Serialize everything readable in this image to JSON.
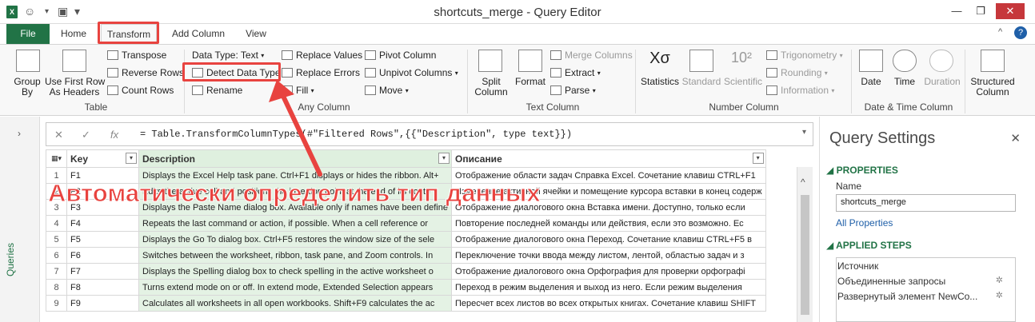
{
  "window": {
    "title": "shortcuts_merge - Query Editor",
    "app_icon": "X",
    "buttons": {
      "minimize": "—",
      "restore": "❐",
      "close": "✕"
    }
  },
  "tabs": [
    "File",
    "Home",
    "Transform",
    "Add Column",
    "View"
  ],
  "ribbon": {
    "table_group": {
      "label": "Table",
      "group_by": "Group\nBy",
      "use_first_row": "Use First Row\nAs Headers",
      "transpose": "Transpose",
      "reverse_rows": "Reverse Rows",
      "count_rows": "Count Rows"
    },
    "any_column_group": {
      "label": "Any Column",
      "data_type": "Data Type: Text",
      "detect_data_type": "Detect Data Type",
      "rename": "Rename",
      "replace_values": "Replace Values",
      "replace_errors": "Replace Errors",
      "fill": "Fill",
      "pivot_column": "Pivot Column",
      "unpivot_columns": "Unpivot Columns",
      "move": "Move"
    },
    "text_column_group": {
      "label": "Text Column",
      "split_column": "Split\nColumn",
      "format": "Format",
      "merge_columns": "Merge Columns",
      "extract": "Extract",
      "parse": "Parse"
    },
    "number_column_group": {
      "label": "Number Column",
      "statistics": "Statistics",
      "standard": "Standard",
      "scientific": "Scientific",
      "trigonometry": "Trigonometry",
      "rounding": "Rounding",
      "information": "Information"
    },
    "datetime_group": {
      "label": "Date & Time Column",
      "date": "Date",
      "time": "Time",
      "duration": "Duration"
    },
    "structured": {
      "label": "Structured\nColumn"
    }
  },
  "left_nav": {
    "label": "Queries",
    "arrow": "›"
  },
  "formula_bar": {
    "cancel": "✕",
    "confirm": "✓",
    "fx": "fx",
    "formula": "= Table.TransformColumnTypes(#\"Filtered Rows\",{{\"Description\", type text}})"
  },
  "grid": {
    "columns": [
      "Key",
      "Description",
      "Описание"
    ],
    "rows": [
      {
        "n": "1",
        "key": "F1",
        "desc": "Displays the Excel Help task pane. Ctrl+F1 displays or hides the ribbon. Alt+",
        "ru": "Отображение области задач Справка Excel. Сочетание клавиш CTRL+F1"
      },
      {
        "n": "2",
        "key": "F2",
        "desc": "Edits the active cell and positions the insertion point at the end of its conte",
        "ru": "Изменение активной ячейки и помещение курсора вставки в конец содерж"
      },
      {
        "n": "3",
        "key": "F3",
        "desc": "Displays the Paste Name dialog box. Available only if names have been define",
        "ru": "Отображение диалогового окна Вставка имени. Доступно, только если"
      },
      {
        "n": "4",
        "key": "F4",
        "desc": "Repeats the last command or action, if possible. When a cell reference or",
        "ru": "Повторение последней команды или действия, если это возможно. Ес"
      },
      {
        "n": "5",
        "key": "F5",
        "desc": "Displays the Go To dialog box. Ctrl+F5 restores the window size of the sele",
        "ru": "Отображение диалогового окна Переход. Сочетание клавиш CTRL+F5 в"
      },
      {
        "n": "6",
        "key": "F6",
        "desc": "Switches between the worksheet, ribbon, task pane, and Zoom controls. In",
        "ru": "Переключение точки ввода между листом, лентой, областью задач и з"
      },
      {
        "n": "7",
        "key": "F7",
        "desc": "Displays the Spelling dialog box to check spelling in the active worksheet o",
        "ru": "Отображение диалогового окна Орфография для проверки орфографі"
      },
      {
        "n": "8",
        "key": "F8",
        "desc": "Turns extend mode on or off. In extend mode, Extended Selection appears",
        "ru": "Переход в режим выделения и выход из него. Если режим выделения"
      },
      {
        "n": "9",
        "key": "F9",
        "desc": "Calculates all worksheets in all open workbooks. Shift+F9 calculates the ac",
        "ru": "Пересчет всех листов во всех открытых книгах. Сочетание клавиш SHIFT"
      }
    ]
  },
  "query_settings": {
    "title": "Query Settings",
    "close": "✕",
    "properties_label": "PROPERTIES",
    "name_label": "Name",
    "name_value": "shortcuts_merge",
    "all_properties": "All Properties",
    "applied_steps_label": "APPLIED STEPS",
    "steps": [
      "Источник",
      "Объединенные запросы",
      "Развернутый элемент NewCo..."
    ]
  },
  "annotation": {
    "text": "Автоматически определить тип данных",
    "color": "#e8433f"
  }
}
